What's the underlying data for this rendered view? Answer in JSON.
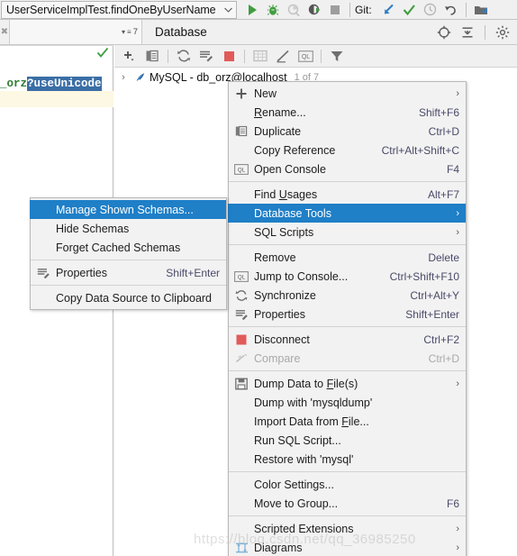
{
  "topbar": {
    "run_configuration": "UserServiceImplTest.findOneByUserName",
    "dropdown_icon": "chevron-down-icon",
    "git_label": "Git:",
    "buttons": [
      {
        "name": "run-button",
        "icon": "play-icon"
      },
      {
        "name": "debug-button",
        "icon": "bug-icon"
      },
      {
        "name": "run-with-coverage-button",
        "icon": "coverage-icon"
      },
      {
        "name": "run-profiler-button",
        "icon": "profile-run-icon"
      },
      {
        "name": "stop-button",
        "icon": "stop-square-icon"
      },
      {
        "name": "git-update-button",
        "icon": "arrow-down-left-icon"
      },
      {
        "name": "git-commit-button",
        "icon": "checkmark-icon"
      },
      {
        "name": "git-history-button",
        "icon": "clock-icon"
      },
      {
        "name": "git-rollback-button",
        "icon": "undo-arrow-icon"
      },
      {
        "name": "project-structure-button",
        "icon": "folder-modules-icon"
      }
    ]
  },
  "panel": {
    "search_count": "7",
    "title": "Database",
    "header_buttons": [
      {
        "name": "scroll-from-source-button",
        "icon": "target-crosshair-icon"
      },
      {
        "name": "collapse-all-button",
        "icon": "collapse-all-icon"
      },
      {
        "name": "settings-button",
        "icon": "gear-icon"
      }
    ]
  },
  "editor": {
    "code_plain": "_orz",
    "code_selected": "?useUnicode",
    "inspection_icon": "checkmark-ok-icon"
  },
  "db_toolbar": {
    "buttons": [
      {
        "name": "add-data-source-button",
        "icon": "plus-dropdown-icon"
      },
      {
        "name": "duplicate-button",
        "icon": "copy-icon"
      },
      {
        "name": "synchronize-button",
        "icon": "refresh-icon"
      },
      {
        "name": "properties-button",
        "icon": "properties-wrench-icon"
      },
      {
        "name": "disconnect-button",
        "icon": "red-square-icon"
      },
      {
        "name": "jump-to-data-button",
        "icon": "table-grid-icon"
      },
      {
        "name": "edit-data-button",
        "icon": "pencil-icon"
      },
      {
        "name": "open-console-button",
        "icon": "ql-console-icon"
      },
      {
        "name": "filter-button",
        "icon": "funnel-icon"
      }
    ]
  },
  "db_tree": {
    "rows": [
      {
        "expand_icon": "chevron-right-icon",
        "db_icon": "mysql-dolphin-icon",
        "label": "MySQL - db_orz@localhost",
        "sub": "1 of 7"
      }
    ]
  },
  "context_menu": {
    "groups": [
      {
        "items": [
          {
            "name": "menu-item-new",
            "label": "New",
            "accel": "",
            "icon": "plus-icon",
            "arrow": true,
            "selected": false,
            "disabled": false,
            "underline_index": -1
          },
          {
            "name": "menu-item-rename",
            "label": "Rename...",
            "accel": "Shift+F6",
            "icon": "",
            "arrow": false,
            "selected": false,
            "disabled": false,
            "underline_index": 0
          },
          {
            "name": "menu-item-duplicate",
            "label": "Duplicate",
            "accel": "Ctrl+D",
            "icon": "copy-icon",
            "arrow": false,
            "selected": false,
            "disabled": false,
            "underline_index": -1
          },
          {
            "name": "menu-item-copy-reference",
            "label": "Copy Reference",
            "accel": "Ctrl+Alt+Shift+C",
            "icon": "",
            "arrow": false,
            "selected": false,
            "disabled": false,
            "underline_index": -1
          },
          {
            "name": "menu-item-open-console",
            "label": "Open Console",
            "accel": "F4",
            "icon": "ql-console-icon",
            "arrow": false,
            "selected": false,
            "disabled": false,
            "underline_index": -1
          }
        ]
      },
      {
        "items": [
          {
            "name": "menu-item-find-usages",
            "label": "Find Usages",
            "accel": "Alt+F7",
            "icon": "",
            "arrow": false,
            "selected": false,
            "disabled": false,
            "underline_index": 5
          },
          {
            "name": "menu-item-database-tools",
            "label": "Database Tools",
            "accel": "",
            "icon": "",
            "arrow": true,
            "selected": true,
            "disabled": false,
            "underline_index": -1
          },
          {
            "name": "menu-item-sql-scripts",
            "label": "SQL Scripts",
            "accel": "",
            "icon": "",
            "arrow": true,
            "selected": false,
            "disabled": false,
            "underline_index": -1
          }
        ]
      },
      {
        "items": [
          {
            "name": "menu-item-remove",
            "label": "Remove",
            "accel": "Delete",
            "icon": "",
            "arrow": false,
            "selected": false,
            "disabled": false,
            "underline_index": -1
          },
          {
            "name": "menu-item-jump-to-console",
            "label": "Jump to Console...",
            "accel": "Ctrl+Shift+F10",
            "icon": "ql-console-icon",
            "arrow": false,
            "selected": false,
            "disabled": false,
            "underline_index": -1
          },
          {
            "name": "menu-item-synchronize",
            "label": "Synchronize",
            "accel": "Ctrl+Alt+Y",
            "icon": "refresh-icon",
            "arrow": false,
            "selected": false,
            "disabled": false,
            "underline_index": -1
          },
          {
            "name": "menu-item-properties",
            "label": "Properties",
            "accel": "Shift+Enter",
            "icon": "properties-wrench-icon",
            "arrow": false,
            "selected": false,
            "disabled": false,
            "underline_index": -1
          }
        ]
      },
      {
        "items": [
          {
            "name": "menu-item-disconnect",
            "label": "Disconnect",
            "accel": "Ctrl+F2",
            "icon": "red-square-icon",
            "arrow": false,
            "selected": false,
            "disabled": false,
            "underline_index": -1
          },
          {
            "name": "menu-item-compare",
            "label": "Compare",
            "accel": "Ctrl+D",
            "icon": "compare-icon",
            "arrow": false,
            "selected": false,
            "disabled": true,
            "underline_index": -1
          }
        ]
      },
      {
        "items": [
          {
            "name": "menu-item-dump-data-to-files",
            "label": "Dump Data to File(s)",
            "accel": "",
            "icon": "floppy-save-icon",
            "arrow": true,
            "selected": false,
            "disabled": false,
            "underline_index": 13
          },
          {
            "name": "menu-item-dump-with-mysqldump",
            "label": "Dump with 'mysqldump'",
            "accel": "",
            "icon": "",
            "arrow": false,
            "selected": false,
            "disabled": false,
            "underline_index": -1
          },
          {
            "name": "menu-item-import-data-from-file",
            "label": "Import Data from File...",
            "accel": "",
            "icon": "",
            "arrow": false,
            "selected": false,
            "disabled": false,
            "underline_index": 17
          },
          {
            "name": "menu-item-run-sql-script",
            "label": "Run SQL Script...",
            "accel": "",
            "icon": "",
            "arrow": false,
            "selected": false,
            "disabled": false,
            "underline_index": -1
          },
          {
            "name": "menu-item-restore-with-mysql",
            "label": "Restore with 'mysql'",
            "accel": "",
            "icon": "",
            "arrow": false,
            "selected": false,
            "disabled": false,
            "underline_index": -1
          }
        ]
      },
      {
        "items": [
          {
            "name": "menu-item-color-settings",
            "label": "Color Settings...",
            "accel": "",
            "icon": "",
            "arrow": false,
            "selected": false,
            "disabled": false,
            "underline_index": -1
          },
          {
            "name": "menu-item-move-to-group",
            "label": "Move to Group...",
            "accel": "F6",
            "icon": "",
            "arrow": false,
            "selected": false,
            "disabled": false,
            "underline_index": -1
          }
        ]
      },
      {
        "items": [
          {
            "name": "menu-item-scripted-extensions",
            "label": "Scripted Extensions",
            "accel": "",
            "icon": "",
            "arrow": true,
            "selected": false,
            "disabled": false,
            "underline_index": -1
          },
          {
            "name": "menu-item-diagrams",
            "label": "Diagrams",
            "accel": "",
            "icon": "diagram-icon",
            "arrow": true,
            "selected": false,
            "disabled": false,
            "underline_index": -1
          }
        ]
      }
    ]
  },
  "submenu": {
    "groups": [
      {
        "items": [
          {
            "name": "submenu-item-manage-shown-schemas",
            "label": "Manage Shown Schemas...",
            "accel": "",
            "icon": "",
            "arrow": false,
            "selected": true,
            "disabled": false
          },
          {
            "name": "submenu-item-hide-schemas",
            "label": "Hide Schemas",
            "accel": "",
            "icon": "",
            "arrow": false,
            "selected": false,
            "disabled": false
          },
          {
            "name": "submenu-item-forget-cached-schemas",
            "label": "Forget Cached Schemas",
            "accel": "",
            "icon": "",
            "arrow": false,
            "selected": false,
            "disabled": false
          }
        ]
      },
      {
        "items": [
          {
            "name": "submenu-item-properties",
            "label": "Properties",
            "accel": "Shift+Enter",
            "icon": "properties-wrench-icon",
            "arrow": false,
            "selected": false,
            "disabled": false
          }
        ]
      },
      {
        "items": [
          {
            "name": "submenu-item-copy-data-source-to-clipboard",
            "label": "Copy Data Source to Clipboard",
            "accel": "",
            "icon": "",
            "arrow": false,
            "selected": false,
            "disabled": false
          }
        ]
      }
    ]
  },
  "watermark": {
    "text": "https://blog.csdn.net/qq_36985250"
  },
  "colors": {
    "menu_bg": "#f2f2f2",
    "selection_blue": "#1f7fc7",
    "accel_text": "#4a4a6a",
    "toolbar_bg": "#f0f0f0",
    "editor_selection": "#3a6ea5",
    "highlight_line": "#fdf8e3",
    "stop_red": "#e15b5b",
    "run_green": "#3f9e3f"
  }
}
